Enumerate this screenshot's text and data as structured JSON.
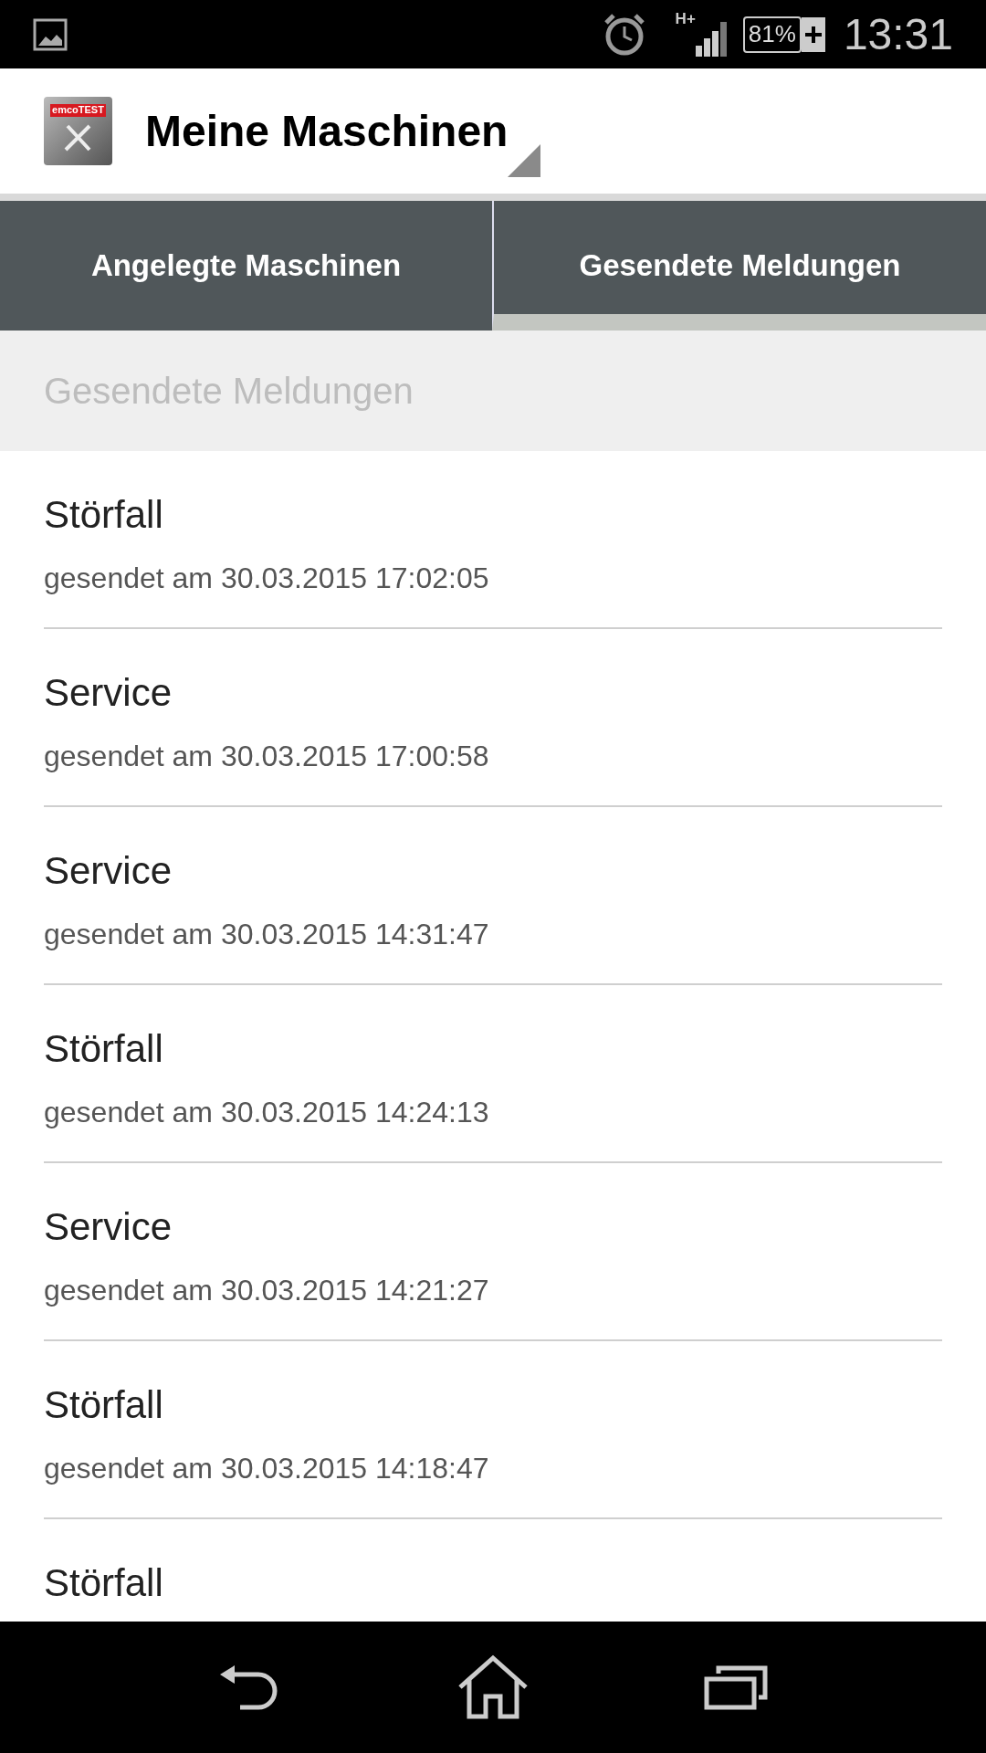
{
  "status_bar": {
    "network": "H+",
    "battery": "81%",
    "time": "13:31"
  },
  "app_bar": {
    "logo_text": "emcoTEST",
    "title": "Meine Maschinen"
  },
  "tabs": [
    {
      "label": "Angelegte Maschinen",
      "selected": false
    },
    {
      "label": "Gesendete Meldungen",
      "selected": true
    }
  ],
  "section_header": "Gesendete Meldungen",
  "messages": [
    {
      "title": "Störfall",
      "subtitle": "gesendet am 30.03.2015 17:02:05"
    },
    {
      "title": "Service",
      "subtitle": "gesendet am 30.03.2015 17:00:58"
    },
    {
      "title": "Service",
      "subtitle": "gesendet am 30.03.2015 14:31:47"
    },
    {
      "title": "Störfall",
      "subtitle": "gesendet am 30.03.2015 14:24:13"
    },
    {
      "title": "Service",
      "subtitle": "gesendet am 30.03.2015 14:21:27"
    },
    {
      "title": "Störfall",
      "subtitle": "gesendet am 30.03.2015 14:18:47"
    },
    {
      "title": "Störfall"
    }
  ]
}
